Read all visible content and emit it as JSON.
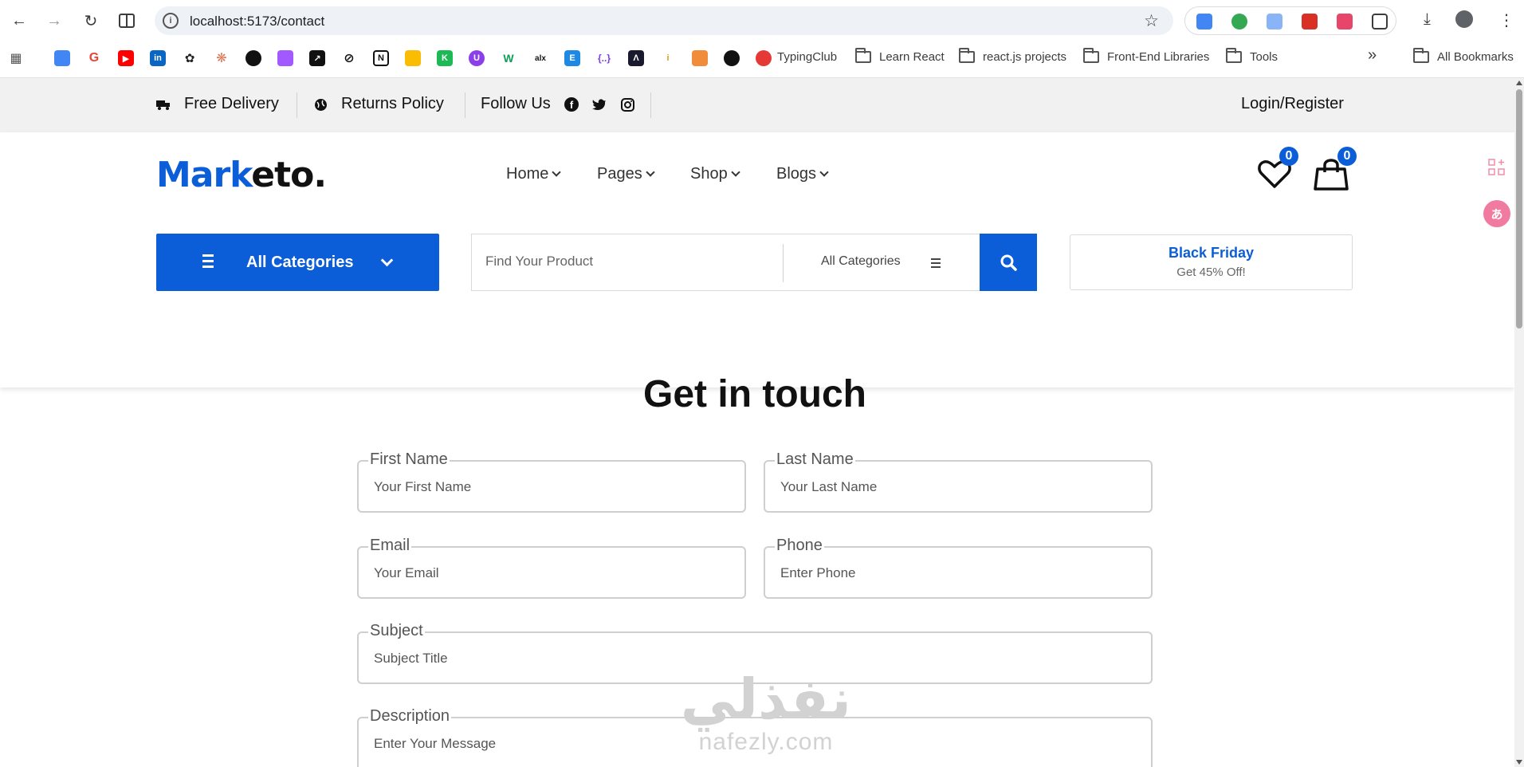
{
  "browser": {
    "url": "localhost:5173/contact",
    "bookmarks": {
      "items": [
        "TypingClub",
        "Learn React",
        "react.js projects",
        "Front-End Libraries",
        "Tools"
      ],
      "all_bookmarks": "All Bookmarks",
      "overflow": "»"
    }
  },
  "topbar": {
    "free_delivery": "Free Delivery",
    "returns_policy": "Returns Policy",
    "follow_us": "Follow Us",
    "login_register": "Login/Register"
  },
  "header": {
    "logo_part1": "Mark",
    "logo_part2": "eto.",
    "nav": [
      "Home",
      "Pages",
      "Shop",
      "Blogs"
    ],
    "wishlist_count": "0",
    "cart_count": "0"
  },
  "searchbar": {
    "categories_button": "All Categories",
    "search_placeholder": "Find Your Product",
    "category_select": "All Categories",
    "promo_title": "Black Friday",
    "promo_subtitle": "Get 45% Off!"
  },
  "contact": {
    "heading": "Get in touch",
    "fields": {
      "first_name": {
        "label": "First Name",
        "placeholder": "Your First Name"
      },
      "last_name": {
        "label": "Last Name",
        "placeholder": "Your Last Name"
      },
      "email": {
        "label": "Email",
        "placeholder": "Your Email"
      },
      "phone": {
        "label": "Phone",
        "placeholder": "Enter Phone"
      },
      "subject": {
        "label": "Subject",
        "placeholder": "Subject Title"
      },
      "description": {
        "label": "Description",
        "placeholder": "Enter Your Message"
      }
    }
  },
  "watermark": {
    "arabic": "نفذلي",
    "latin": "nafezly.com"
  },
  "colors": {
    "brand_blue": "#0b5ed7",
    "topbar_bg": "#f1f1f1",
    "text_dark": "#111111"
  }
}
